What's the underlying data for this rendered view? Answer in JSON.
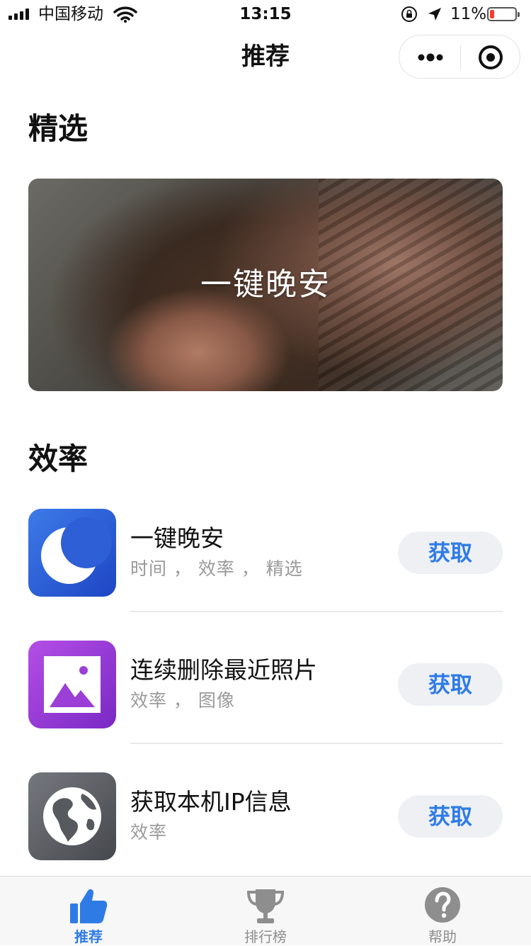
{
  "status_bar": {
    "carrier": "中国移动",
    "time": "13:15",
    "battery_percent": "11%",
    "battery_level": 0.11,
    "icons": [
      "signal-icon",
      "wifi-icon",
      "rotation-lock-icon",
      "location-arrow-icon",
      "battery-icon"
    ]
  },
  "nav": {
    "title": "推荐",
    "capsule_icons": [
      "more-dots-icon",
      "close-target-icon"
    ]
  },
  "featured": {
    "section_title": "精选",
    "banner_label": "一键晚安"
  },
  "efficiency": {
    "section_title": "效率",
    "items": [
      {
        "name": "一键晚安",
        "tags": "时间 ， 效率 ， 精选",
        "button": "获取",
        "icon": "moon-icon",
        "color": "#2f6be3"
      },
      {
        "name": "连续删除最近照片",
        "tags": "效率 ， 图像",
        "button": "获取",
        "icon": "photo-icon",
        "color": "#9b3fd6"
      },
      {
        "name": "获取本机IP信息",
        "tags": "效率",
        "button": "获取",
        "icon": "globe-icon",
        "color": "#5a5d63"
      }
    ]
  },
  "tab_bar": {
    "tabs": [
      {
        "label": "推荐",
        "icon": "thumbs-up-icon",
        "active": true
      },
      {
        "label": "排行榜",
        "icon": "trophy-icon",
        "active": false
      },
      {
        "label": "帮助",
        "icon": "help-icon",
        "active": false
      }
    ]
  },
  "colors": {
    "accent": "#2f7be6",
    "button_bg": "#eef0f4",
    "battery_low": "#ff3b30"
  }
}
